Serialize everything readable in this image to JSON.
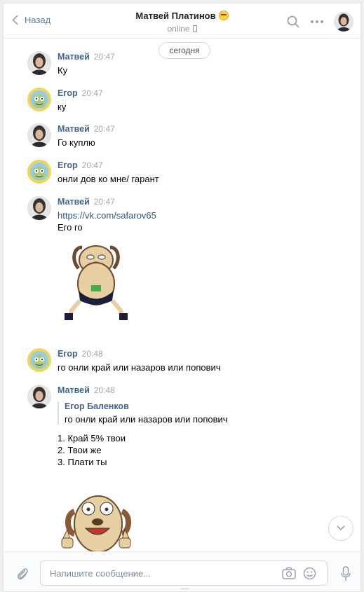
{
  "header": {
    "back_label": "Назад",
    "peer_name": "Матвей Платинов",
    "status": "online"
  },
  "chat": {
    "date_label": "сегодня",
    "messages": [
      {
        "author": "Матвей",
        "time": "20:47",
        "text": "Ку"
      },
      {
        "author": "Егор",
        "time": "20:47",
        "text": "ку"
      },
      {
        "author": "Матвей",
        "time": "20:47",
        "text": "Го куплю"
      },
      {
        "author": "Егор",
        "time": "20:47",
        "text": "онли дов ко мне/ гарант"
      },
      {
        "author": "Матвей",
        "time": "20:47",
        "link": "https://vk.com/safarov65",
        "text": "Его го"
      },
      {
        "author": "Егор",
        "time": "20:48",
        "text": "го онли край или назаров или попович"
      },
      {
        "author": "Матвей",
        "time": "20:48",
        "reply": {
          "author": "Егор Баленков",
          "text": "го онли край или назаров или попович"
        },
        "lines": [
          "1. Край 5% твои",
          "2. Твои же",
          "3. Плати ты"
        ]
      }
    ]
  },
  "composer": {
    "placeholder": "Напишите сообщение..."
  },
  "colors": {
    "author": "#42648b",
    "link": "#2a5885",
    "muted": "#a0a6ad",
    "back": "#5f7a99"
  },
  "icons": [
    "chevron-left-icon",
    "search-icon",
    "more-icon",
    "attach-icon",
    "camera-icon",
    "smile-icon",
    "mic-icon",
    "chevron-down-icon"
  ]
}
